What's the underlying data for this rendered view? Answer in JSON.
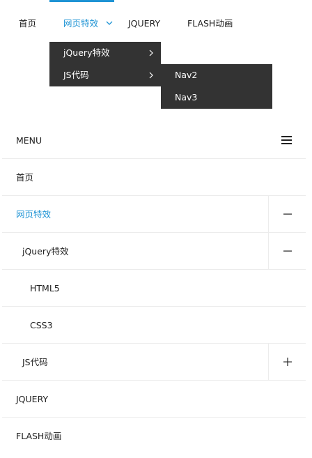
{
  "topnav": {
    "items": [
      {
        "label": "首页",
        "active": false
      },
      {
        "label": "网页特效",
        "active": true
      },
      {
        "label": "JQUERY",
        "active": false
      },
      {
        "label": "FLASH动画",
        "active": false
      }
    ],
    "dropdown": {
      "items": [
        {
          "label": "jQuery特效"
        },
        {
          "label": "JS代码"
        }
      ]
    },
    "subdropdown": {
      "items": [
        {
          "label": "Nav2"
        },
        {
          "label": "Nav3"
        }
      ]
    }
  },
  "mobile": {
    "menu_label": "MENU",
    "items": [
      {
        "label": "首页",
        "level": 0,
        "active": false,
        "toggle": "none"
      },
      {
        "label": "网页特效",
        "level": 0,
        "active": true,
        "toggle": "minus"
      },
      {
        "label": "jQuery特效",
        "level": 1,
        "active": false,
        "toggle": "minus"
      },
      {
        "label": "HTML5",
        "level": 2,
        "active": false,
        "toggle": "none"
      },
      {
        "label": "CSS3",
        "level": 2,
        "active": false,
        "toggle": "none"
      },
      {
        "label": "JS代码",
        "level": 1,
        "active": false,
        "toggle": "plus"
      },
      {
        "label": "JQUERY",
        "level": 0,
        "active": false,
        "toggle": "none"
      },
      {
        "label": "FLASH动画",
        "level": 0,
        "active": false,
        "toggle": "none"
      }
    ]
  },
  "colors": {
    "accent": "#1e93d4",
    "dropdown_bg": "#333333",
    "divider": "#ececec"
  }
}
